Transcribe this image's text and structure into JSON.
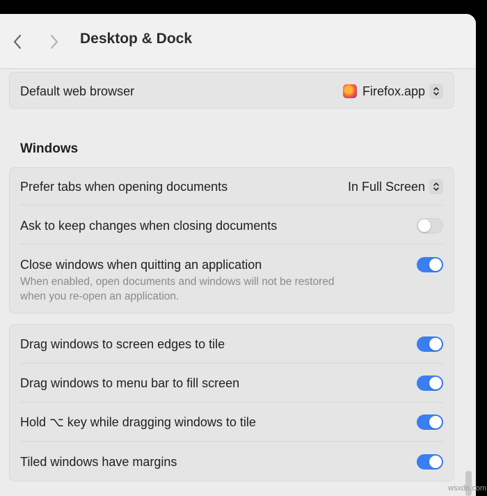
{
  "header": {
    "title": "Desktop & Dock",
    "back_icon": "chevron-left-icon",
    "forward_icon": "chevron-right-icon"
  },
  "browser_card": {
    "label": "Default web browser",
    "value": "Firefox.app",
    "icon": "firefox-icon"
  },
  "windows_section": {
    "title": "Windows",
    "prefer_tabs": {
      "label": "Prefer tabs when opening documents",
      "value": "In Full Screen"
    },
    "ask_keep_changes": {
      "label": "Ask to keep changes when closing documents",
      "enabled": false
    },
    "close_windows": {
      "label": "Close windows when quitting an application",
      "description_line1": "When enabled, open documents and windows will not be restored",
      "description_line2": "when you re-open an application.",
      "enabled": true
    }
  },
  "tiling_card": {
    "items": [
      {
        "label": "Drag windows to screen edges to tile",
        "enabled": true
      },
      {
        "label": "Drag windows to menu bar to fill screen",
        "enabled": true
      },
      {
        "label": "Hold ⌥ key while dragging windows to tile",
        "enabled": true
      },
      {
        "label": "Tiled windows have margins",
        "enabled": true
      }
    ]
  },
  "colors": {
    "accent": "#3a7ef0",
    "toggle_off": "#dcdcdc"
  },
  "watermark": "wsxdn.com"
}
